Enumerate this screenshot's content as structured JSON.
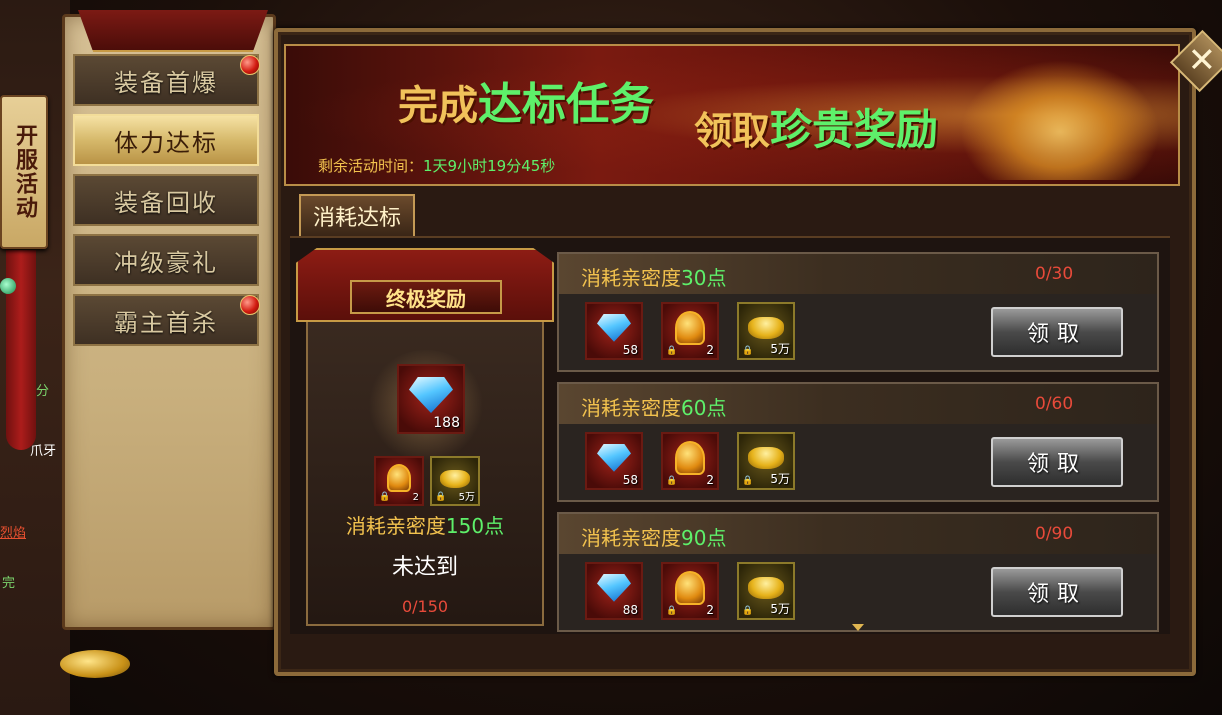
{
  "event_hanger": "开服活动",
  "left_fragments": [
    "分",
    "爪牙",
    "烈焰",
    "完"
  ],
  "sidebar": {
    "items": [
      {
        "label": "装备首爆",
        "badge": true
      },
      {
        "label": "体力达标",
        "active": true
      },
      {
        "label": "装备回收"
      },
      {
        "label": "冲级豪礼"
      },
      {
        "label": "霸主首杀",
        "badge": true
      }
    ]
  },
  "banner": {
    "part1_prefix": "完成",
    "part1_highlight": "达标任务",
    "part2_prefix": "领取",
    "part2_highlight": "珍贵奖励",
    "timer_label": "剩余活动时间：",
    "timer_value": "1天9小时19分45秒"
  },
  "close_label": "✕",
  "tab": {
    "label": "消耗达标"
  },
  "ultimate": {
    "title": "终极奖励",
    "main_item": {
      "icon": "blue-gem-icon",
      "count": "188"
    },
    "items": [
      {
        "icon": "golden-helmet-icon",
        "count": "2",
        "locked": true
      },
      {
        "icon": "gold-ingot-icon",
        "count": "5万",
        "locked": true
      }
    ],
    "req_prefix": "消耗亲密度",
    "req_value": "150点",
    "status": "未达到",
    "progress": "0/150"
  },
  "tiers": [
    {
      "req_prefix": "消耗亲密度",
      "req_value": "30点",
      "progress": "0/30",
      "items": [
        {
          "icon": "blue-gem-icon",
          "count": "58"
        },
        {
          "icon": "golden-helmet-icon",
          "count": "2"
        },
        {
          "icon": "gold-ingot-icon",
          "count": "5万"
        }
      ],
      "button": "领取"
    },
    {
      "req_prefix": "消耗亲密度",
      "req_value": "60点",
      "progress": "0/60",
      "items": [
        {
          "icon": "blue-gem-icon",
          "count": "58"
        },
        {
          "icon": "golden-helmet-icon",
          "count": "2"
        },
        {
          "icon": "gold-ingot-icon",
          "count": "5万"
        }
      ],
      "button": "领取"
    },
    {
      "req_prefix": "消耗亲密度",
      "req_value": "90点",
      "progress": "0/90",
      "items": [
        {
          "icon": "blue-gem-icon",
          "count": "88"
        },
        {
          "icon": "golden-helmet-icon",
          "count": "2"
        },
        {
          "icon": "gold-ingot-icon",
          "count": "5万"
        }
      ],
      "button": "领取"
    }
  ],
  "colors": {
    "accent_gold": "#f2c24e",
    "accent_green": "#5ef06a",
    "progress_red": "#e74a3a"
  }
}
